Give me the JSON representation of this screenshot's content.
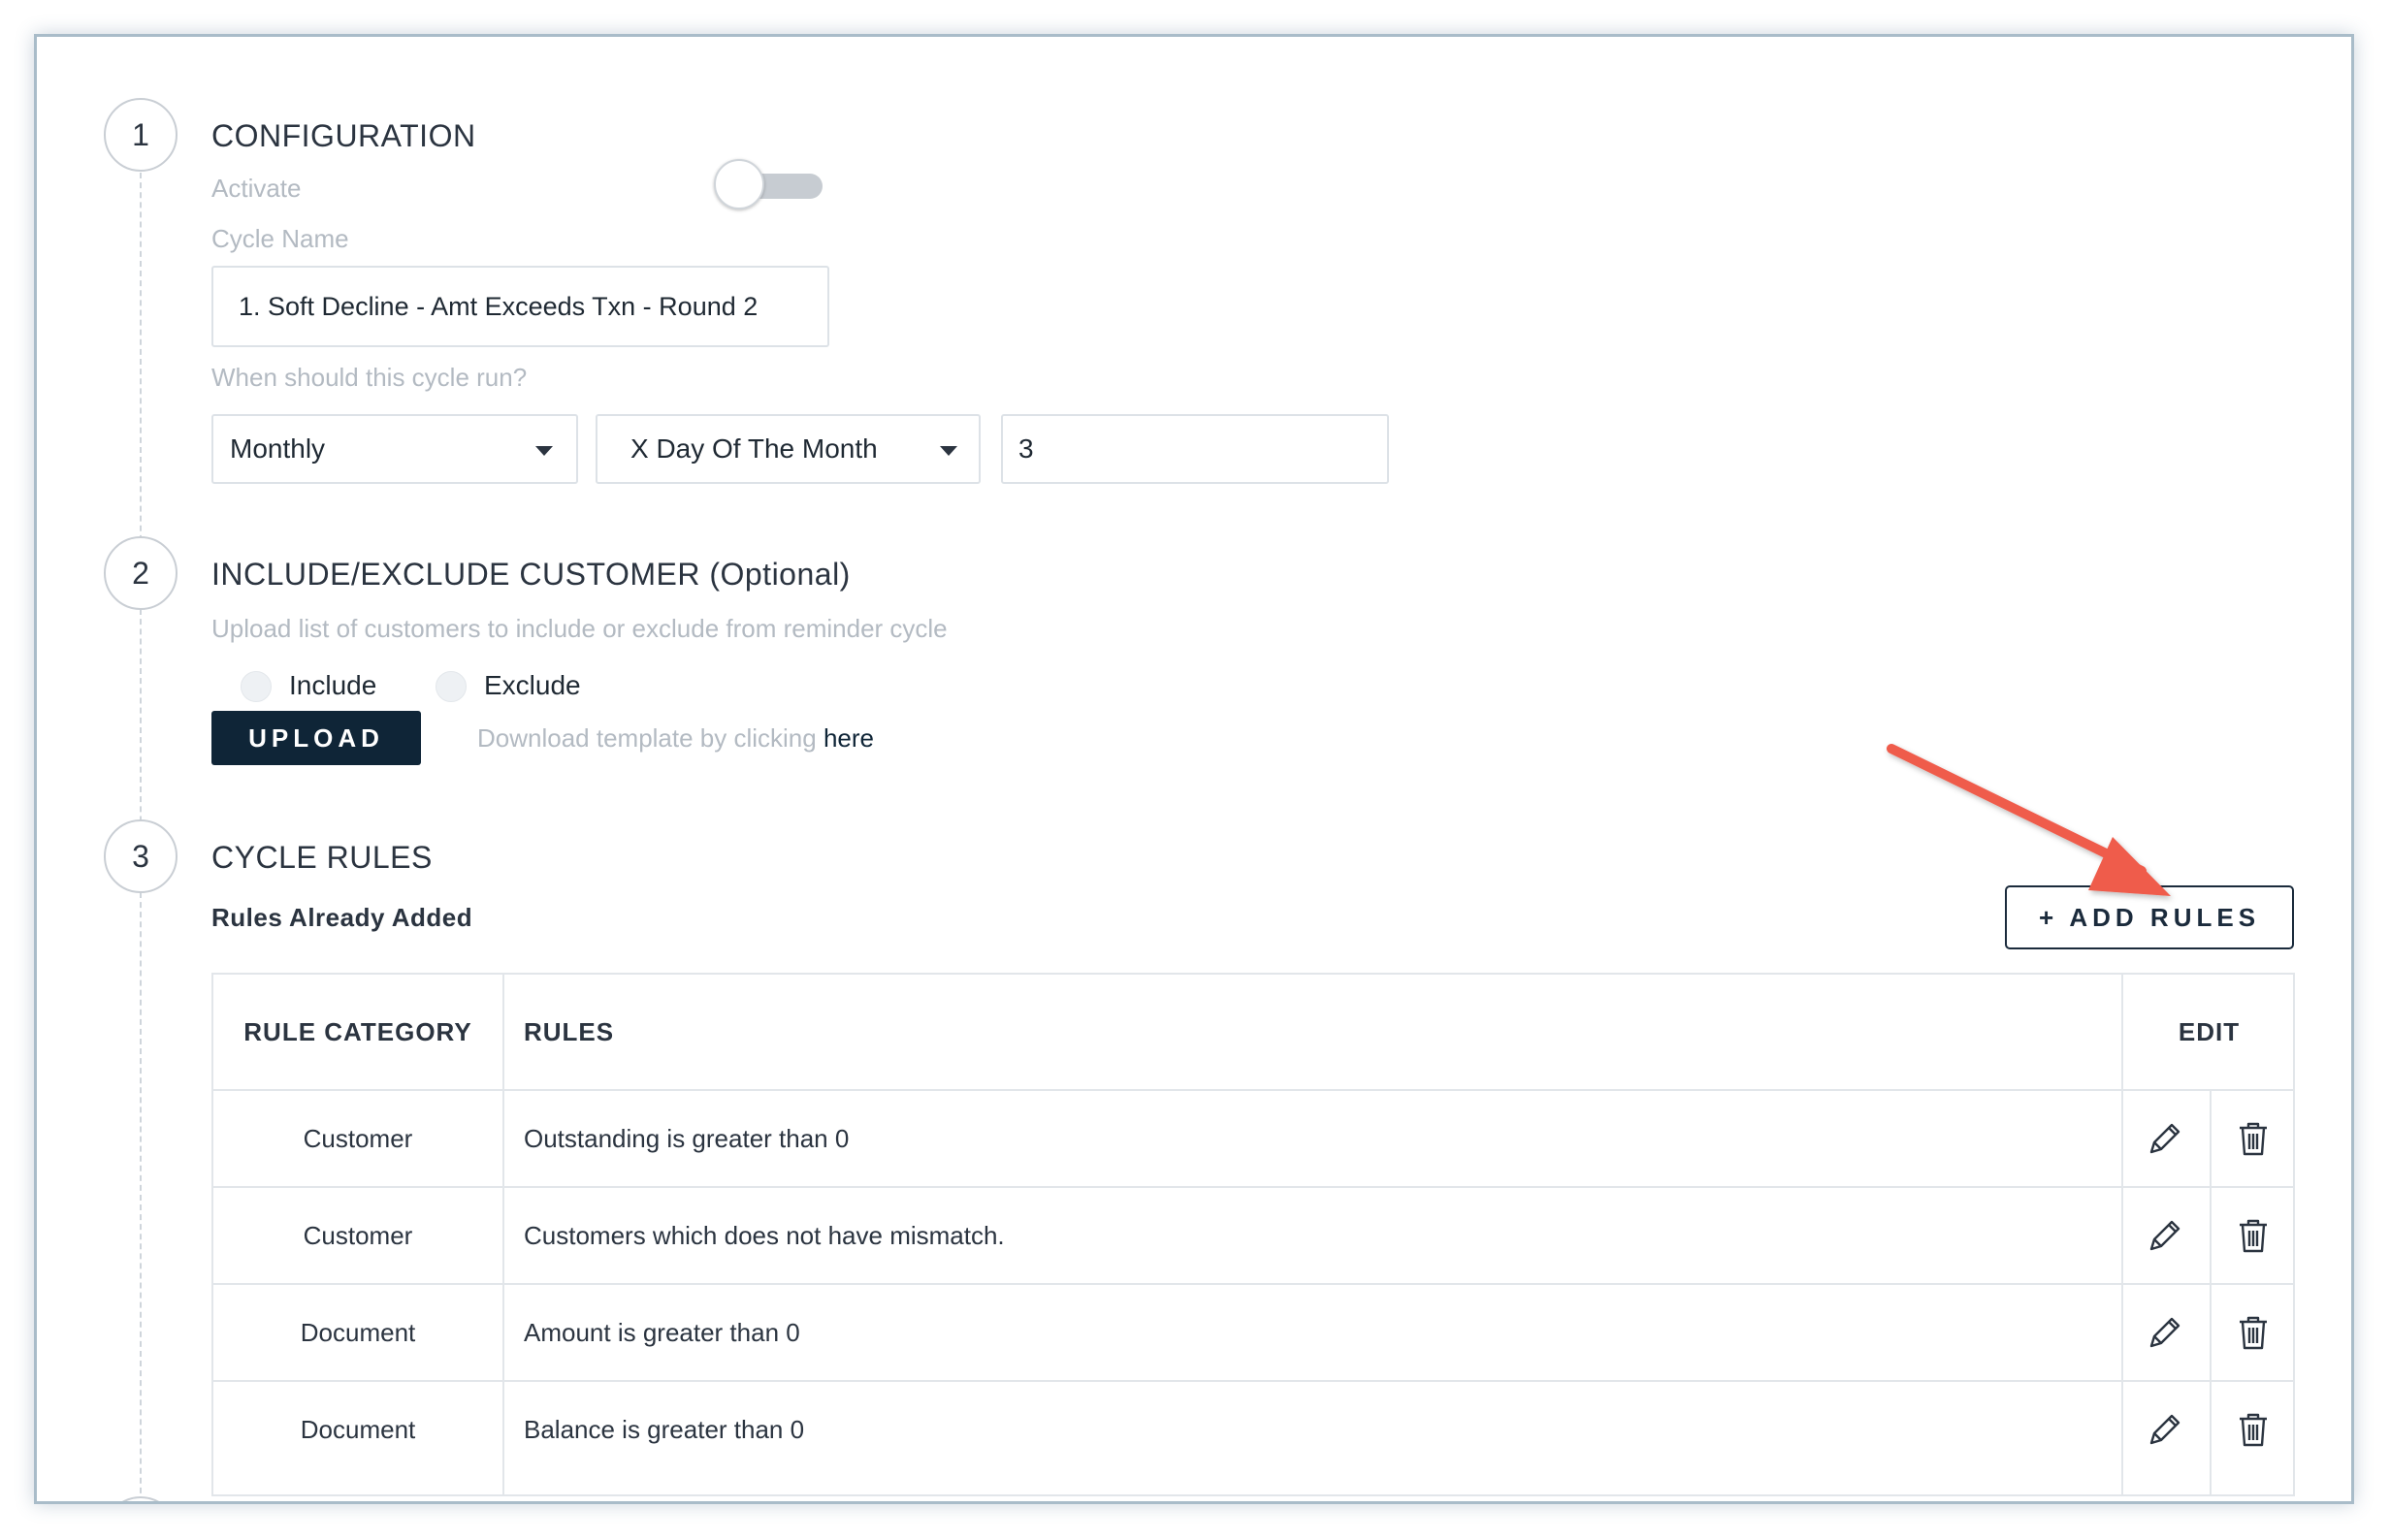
{
  "steps": [
    {
      "number": "1",
      "title": "CONFIGURATION"
    },
    {
      "number": "2",
      "title": "INCLUDE/EXCLUDE CUSTOMER (Optional)"
    },
    {
      "number": "3",
      "title": "CYCLE RULES"
    }
  ],
  "configuration": {
    "activate_label": "Activate",
    "activate_on": false,
    "cycle_name_label": "Cycle Name",
    "cycle_name_value": "1. Soft Decline - Amt Exceeds Txn - Round 2",
    "schedule_label": "When should this cycle run?",
    "frequency": "Monthly",
    "day_type": "X Day Of The Month",
    "day_value": "3"
  },
  "include_exclude": {
    "description": "Upload list of customers to include or exclude from reminder cycle",
    "include_label": "Include",
    "exclude_label": "Exclude",
    "upload_label": "UPLOAD",
    "template_text": "Download template by clicking",
    "template_link": "here"
  },
  "cycle_rules": {
    "subtitle": "Rules Already Added",
    "add_button": "+ ADD RULES",
    "headers": {
      "category": "RULE CATEGORY",
      "rules": "RULES",
      "edit": "EDIT"
    },
    "rows": [
      {
        "category": "Customer",
        "rule": "Outstanding is greater than 0"
      },
      {
        "category": "Customer",
        "rule": "Customers which does not have mismatch."
      },
      {
        "category": "Document",
        "rule": "Amount is greater than 0"
      },
      {
        "category": "Document",
        "rule": "Balance is greater than 0"
      }
    ]
  },
  "icons": {
    "edit": "pencil-icon",
    "delete": "trash-icon",
    "annotation": "red-arrow-icon"
  },
  "colors": {
    "primary_dark": "#0f2537",
    "muted_text": "#b3bac2",
    "annotation_arrow": "#ef5b4c"
  }
}
